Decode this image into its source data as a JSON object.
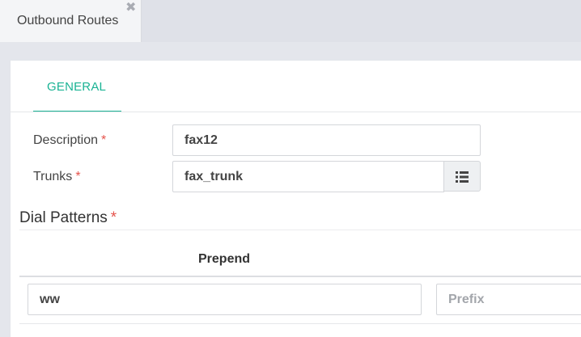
{
  "tabs": {
    "active": {
      "label": "Outbound Routes",
      "close_glyph": "✖"
    }
  },
  "subtabs": {
    "general": "GENERAL"
  },
  "form": {
    "description": {
      "label": "Description",
      "required_mark": "*",
      "value": "fax12"
    },
    "trunks": {
      "label": "Trunks",
      "required_mark": "*",
      "value": "fax_trunk",
      "button_icon": "list-icon"
    }
  },
  "dial_patterns": {
    "title": "Dial Patterns",
    "required_mark": "*",
    "columns": {
      "prepend": "Prepend"
    },
    "row": {
      "prepend_value": "ww",
      "prefix_placeholder": "Prefix"
    }
  },
  "colors": {
    "accent": "#1ab394",
    "required": "#e5534b"
  }
}
